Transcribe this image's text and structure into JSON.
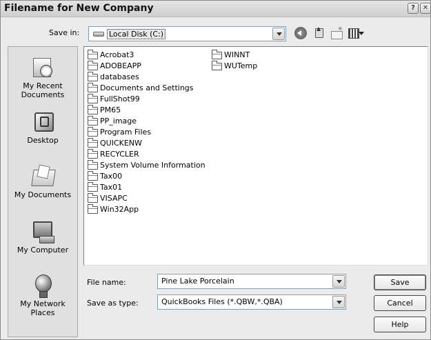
{
  "window": {
    "title": "Filename for New Company",
    "help_glyph": "?",
    "close_glyph": "✕"
  },
  "toolbar": {
    "savein_label": "Save in:",
    "savein_value": "Local Disk (C:)",
    "icons": [
      "back-icon",
      "up-folder-icon",
      "new-folder-icon",
      "views-menu-icon"
    ]
  },
  "places": [
    {
      "name": "recent",
      "label_line1": "My Recent",
      "label_line2": "Documents"
    },
    {
      "name": "desktop",
      "label_line1": "Desktop",
      "label_line2": ""
    },
    {
      "name": "documents",
      "label_line1": "My Documents",
      "label_line2": ""
    },
    {
      "name": "computer",
      "label_line1": "My Computer",
      "label_line2": ""
    },
    {
      "name": "network",
      "label_line1": "My Network",
      "label_line2": "Places"
    }
  ],
  "files": {
    "column1": [
      "Acrobat3",
      "ADOBEAPP",
      "databases",
      "Documents and Settings",
      "FullShot99",
      "PM65",
      "PP_image",
      "Program Files",
      "QUICKENW",
      "RECYCLER",
      "System Volume Information",
      "Tax00",
      "Tax01",
      "VISAPC",
      "Win32App"
    ],
    "column2": [
      "WINNT",
      "WUTemp"
    ]
  },
  "form": {
    "filename_label": "File name:",
    "filename_value": "Pine Lake Porcelain",
    "savetype_label": "Save as type:",
    "savetype_value": "QuickBooks Files (*.QBW,*.QBA)"
  },
  "buttons": {
    "save": "Save",
    "cancel": "Cancel",
    "help": "Help"
  }
}
